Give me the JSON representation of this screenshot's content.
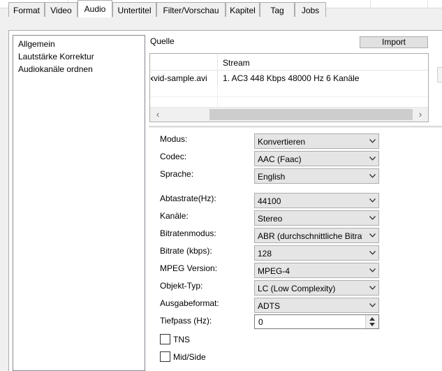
{
  "tabs": [
    "Format",
    "Video",
    "Audio",
    "Untertitel",
    "Filter/Vorschau",
    "Kapitel",
    "Tag",
    "Jobs"
  ],
  "active_tab": "Audio",
  "nav": {
    "items": [
      "Allgemein",
      "Lautstärke Korrektur",
      "Audiokanäle ordnen"
    ]
  },
  "source": {
    "label": "Quelle",
    "import_label": "Import",
    "stream_header": "Stream",
    "file": "xvid-sample.avi",
    "stream": "1. AC3 448 Kbps 48000 Hz 6 Kanäle"
  },
  "fields": {
    "modus": {
      "label": "Modus:",
      "value": "Konvertieren"
    },
    "codec": {
      "label": "Codec:",
      "value": "AAC (Faac)"
    },
    "sprache": {
      "label": "Sprache:",
      "value": "English"
    },
    "abtastrate": {
      "label": "Abtastrate(Hz):",
      "value": "44100"
    },
    "kanaele": {
      "label": "Kanäle:",
      "value": "Stereo"
    },
    "bitratenmodus": {
      "label": "Bitratenmodus:",
      "value": "ABR (durchschnittliche Bitrate)"
    },
    "bitrate": {
      "label": "Bitrate (kbps):",
      "value": "128"
    },
    "mpeg_version": {
      "label": "MPEG Version:",
      "value": "MPEG-4"
    },
    "objekt_typ": {
      "label": "Objekt-Typ:",
      "value": "LC (Low Complexity)"
    },
    "ausgabeformat": {
      "label": "Ausgabeformat:",
      "value": "ADTS"
    },
    "tiefpass": {
      "label": "Tiefpass (Hz):",
      "value": "0"
    }
  },
  "checkboxes": {
    "tns": {
      "label": "TNS",
      "checked": false
    },
    "midside": {
      "label": "Mid/Side",
      "checked": false
    }
  }
}
